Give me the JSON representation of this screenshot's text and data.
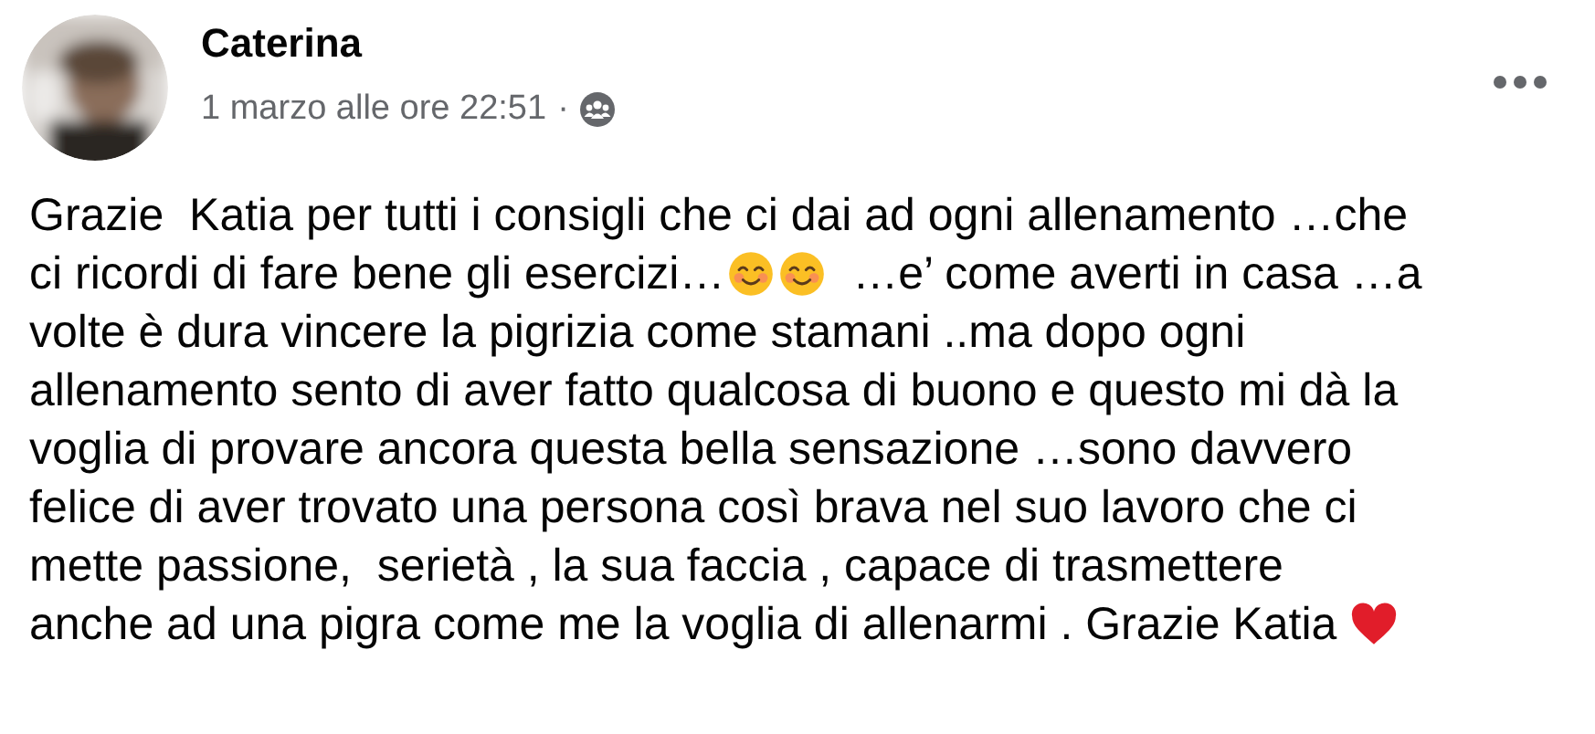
{
  "post": {
    "author": "Caterina",
    "timestamp": "1 marzo alle ore 22:51",
    "separator": "·",
    "lines": [
      [
        {
          "kind": "text",
          "text": "Grazie  Katia per tutti i consigli che ci dai ad ogni allenamento …che"
        }
      ],
      [
        {
          "kind": "text",
          "text": "ci ricordi di fare bene gli esercizi…"
        },
        {
          "kind": "smile"
        },
        {
          "kind": "smile"
        },
        {
          "kind": "text",
          "text": "  …e’ come averti in casa …a"
        }
      ],
      [
        {
          "kind": "text",
          "text": "volte è dura vincere la pigrizia come stamani ..ma dopo ogni"
        }
      ],
      [
        {
          "kind": "text",
          "text": "allenamento sento di aver fatto qualcosa di buono e questo mi dà la"
        }
      ],
      [
        {
          "kind": "text",
          "text": "voglia di provare ancora questa bella sensazione …sono davvero"
        }
      ],
      [
        {
          "kind": "text",
          "text": "felice di aver trovato una persona così brava nel suo lavoro che ci"
        }
      ],
      [
        {
          "kind": "text",
          "text": "mette passione,  serietà , la sua faccia , capace di trasmettere"
        }
      ],
      [
        {
          "kind": "text",
          "text": "anche ad una pigra come me la voglia di allenarmi . Grazie Katia "
        },
        {
          "kind": "heart"
        }
      ]
    ]
  }
}
